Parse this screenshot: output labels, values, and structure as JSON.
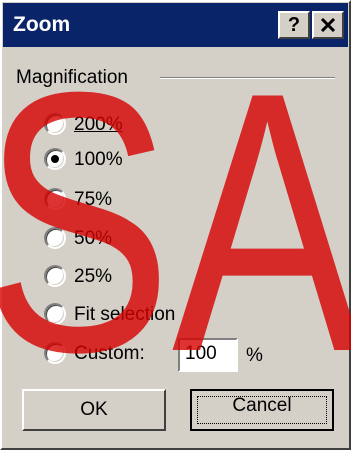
{
  "window": {
    "title": "Zoom",
    "help_label": "?",
    "close_label": "close"
  },
  "magnification": {
    "group_label": "Magnification",
    "options": [
      {
        "label": "200%",
        "checked": false
      },
      {
        "label": "100%",
        "checked": true
      },
      {
        "label": "75%",
        "checked": false
      },
      {
        "label": "50%",
        "checked": false
      },
      {
        "label": "25%",
        "checked": false
      },
      {
        "label": "Fit selection",
        "checked": false
      },
      {
        "label": "Custom:",
        "checked": false
      }
    ],
    "custom_value": "100",
    "custom_unit": "%"
  },
  "buttons": {
    "ok_label": "OK",
    "cancel_label": "Cancel"
  },
  "watermark": {
    "text": "SA",
    "color": "#d40000"
  },
  "colors": {
    "titlebar": "#0a246a",
    "dialog_bg": "#d4d0c8"
  }
}
